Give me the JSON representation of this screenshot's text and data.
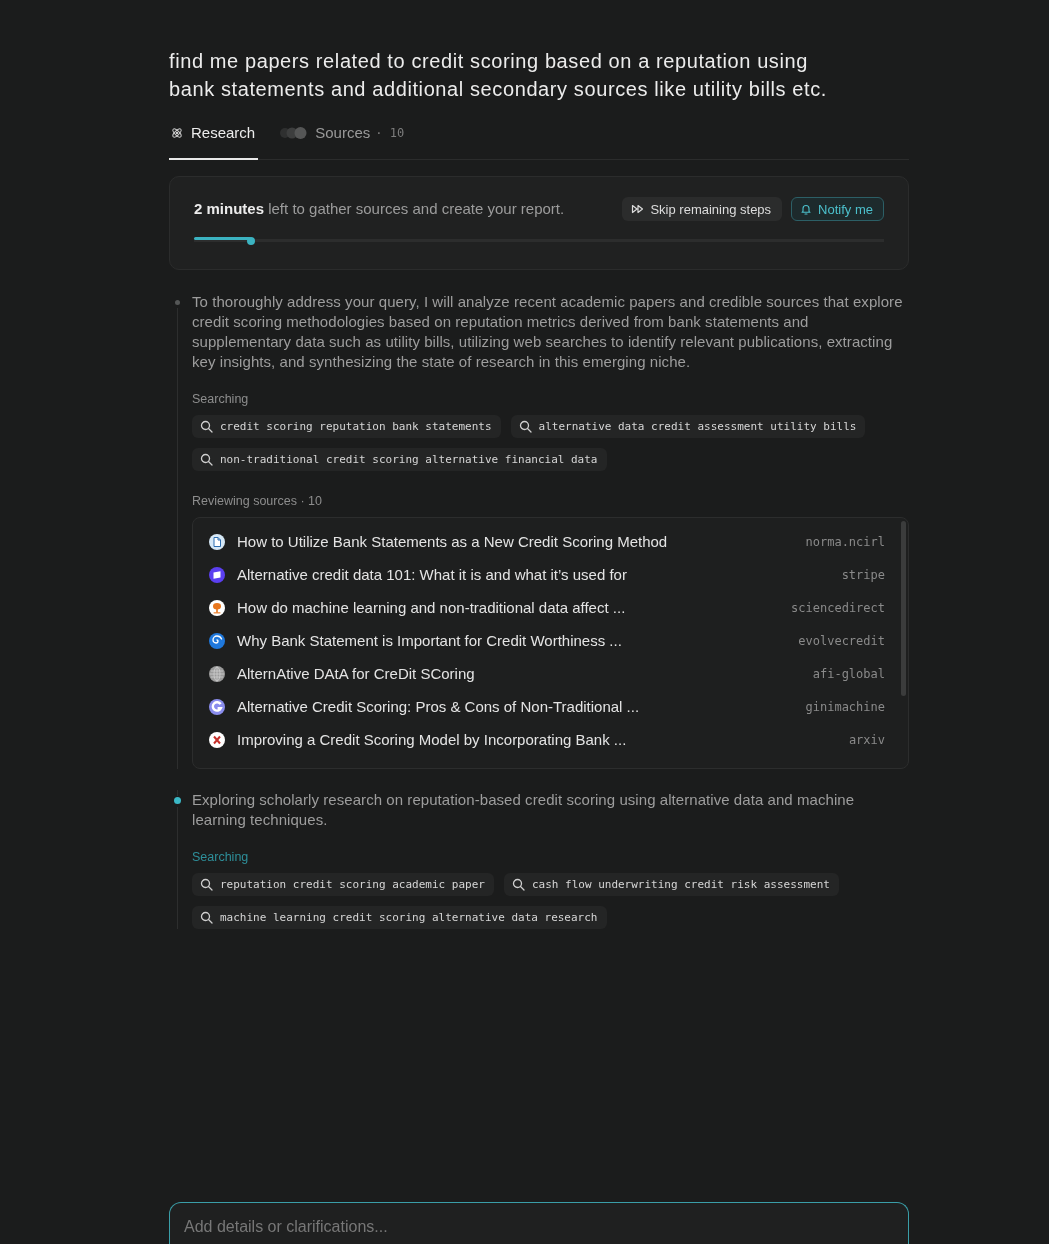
{
  "query": "find me papers related to credit scoring based on a reputation using bank statements and additional secondary sources like utility bills etc.",
  "tabs": [
    {
      "kind": "research",
      "label": "Research",
      "selected": true
    },
    {
      "kind": "sources",
      "label": "Sources",
      "count": "· 10",
      "selected": false
    }
  ],
  "progress": {
    "message": "**2 minutes** left to gather sources and create your report.",
    "level": 0.083,
    "buttons": [
      {
        "kind": "skip",
        "label": "Skip remaining steps"
      },
      {
        "kind": "notify",
        "label": "Notify me"
      }
    ]
  },
  "steps": [
    {
      "active": false,
      "text": "To thoroughly address your query, I will analyze recent academic papers and credible sources that explore credit scoring methodologies based on reputation metrics derived from bank statements and supplementary data such as utility bills, utilizing web searches to identify relevant publications, extracting key insights, and synthesizing the state of research in this emerging niche.",
      "searching": {
        "label": "Searching",
        "queries": [
          "credit scoring reputation bank statements",
          "alternative data credit assessment utility bills",
          "non-traditional credit scoring alternative financial data"
        ]
      },
      "reviewing": {
        "label": "Reviewing sources · 10",
        "sources": [
          {
            "kind": "document",
            "title": "How to Utilize Bank Statements as a New Credit Scoring Method",
            "domain": "norma.ncirl"
          },
          {
            "kind": "tile",
            "title": "Alternative credit data 101: What it is and what it’s used for",
            "domain": "stripe"
          },
          {
            "kind": "tree",
            "title": "How do machine learning and non-traditional data affect ...",
            "domain": "sciencedirect"
          },
          {
            "kind": "spiral",
            "title": "Why Bank Statement is Important for Credit Worthiness ...",
            "domain": "evolvecredit"
          },
          {
            "kind": "globe",
            "title": "AlternAtive DAtA for CreDit SCoring",
            "domain": "afi-global"
          },
          {
            "kind": "arc",
            "title": "Alternative Credit Scoring: Pros & Cons of Non-Traditional ...",
            "domain": "ginimachine"
          },
          {
            "kind": "cross",
            "title": "Improving a Credit Scoring Model by Incorporating Bank ...",
            "domain": "arxiv"
          }
        ]
      }
    },
    {
      "active": true,
      "text": "Exploring scholarly research on reputation-based credit scoring using alternative data and machine learning techniques.",
      "searching": {
        "label": "Searching",
        "queries": [
          "reputation credit scoring academic paper",
          "cash flow underwriting credit risk assessment",
          "machine learning credit scoring alternative data research"
        ]
      }
    }
  ],
  "composer": {
    "placeholder": "Add details or clarifications..."
  }
}
